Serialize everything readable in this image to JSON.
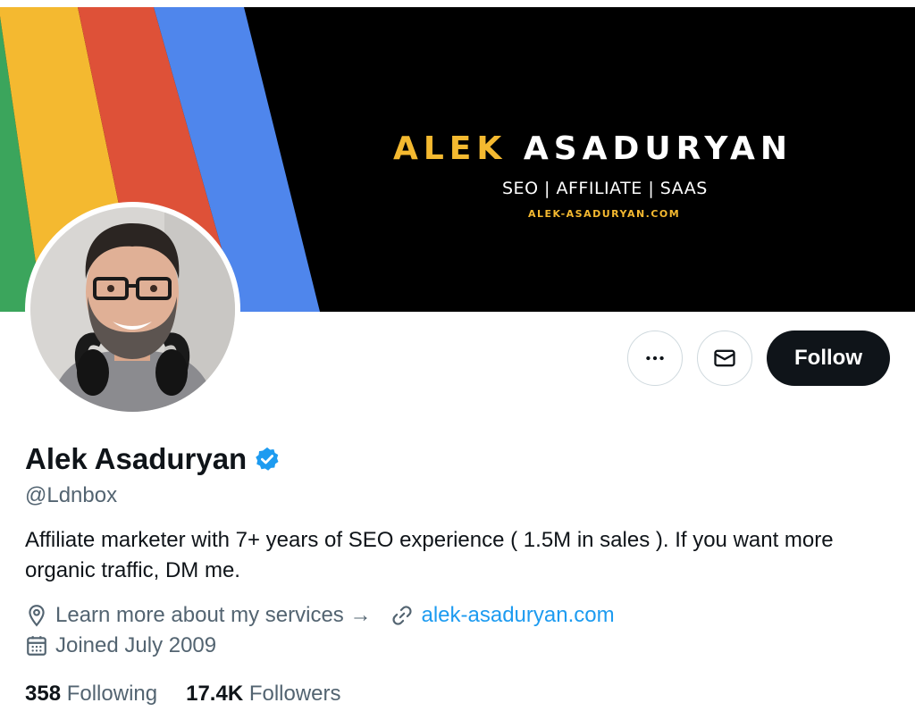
{
  "banner": {
    "name_first": "ALEK",
    "name_last": "ASADURYAN",
    "tagline": "SEO | AFFILIATE | SAAS",
    "website": "ALEK-ASADURYAN.COM",
    "stripe_colors": [
      "#3ba55c",
      "#f4b930",
      "#de5138",
      "#4f86ec"
    ]
  },
  "actions": {
    "more_icon": "more-icon",
    "message_icon": "mail-icon",
    "follow_label": "Follow"
  },
  "profile": {
    "display_name": "Alek Asaduryan",
    "verified_icon": "verified-badge-icon",
    "handle": "@Ldnbox",
    "bio": "Affiliate marketer with 7+ years of SEO experience ( 1.5M in sales ). If you want more organic traffic, DM me.",
    "location": "Learn more about my services →",
    "website": "alek-asaduryan.com",
    "joined": "Joined July 2009"
  },
  "stats": {
    "following_count": "358",
    "following_label": "Following",
    "followers_count": "17.4K",
    "followers_label": "Followers"
  },
  "colors": {
    "accent": "#1d9bf0",
    "text": "#0f1419",
    "muted": "#536471",
    "gold": "#f4b930"
  }
}
